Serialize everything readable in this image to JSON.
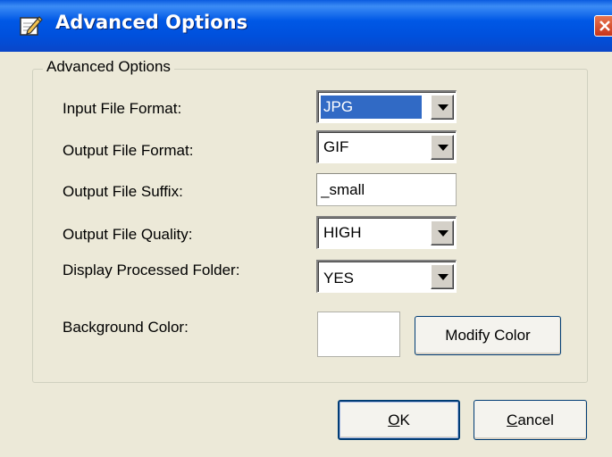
{
  "window": {
    "title": "Advanced Options",
    "title_icon": "edit-icon",
    "close_icon": "close-icon",
    "close_color": "#D9502C",
    "titlebar_color": "#0058E6"
  },
  "group": {
    "legend": "Advanced Options"
  },
  "fields": {
    "input_format": {
      "label": "Input File Format:",
      "value": "JPG",
      "focused": true
    },
    "output_format": {
      "label": "Output File Format:",
      "value": "GIF"
    },
    "output_suffix": {
      "label": "Output File Suffix:",
      "value": "_small"
    },
    "output_quality": {
      "label": "Output File Quality:",
      "value": "HIGH"
    },
    "display_folder": {
      "label": "Display Processed Folder:",
      "value": "YES"
    },
    "background_color": {
      "label": "Background Color:",
      "swatch_color": "#FFFFFF"
    }
  },
  "buttons": {
    "modify_color": "Modify Color",
    "ok": {
      "mnemonic": "O",
      "rest": "K"
    },
    "cancel": {
      "mnemonic": "C",
      "rest": "ancel"
    }
  },
  "colors": {
    "dialog_bg": "#ECE9D8",
    "selection": "#316AC5"
  }
}
